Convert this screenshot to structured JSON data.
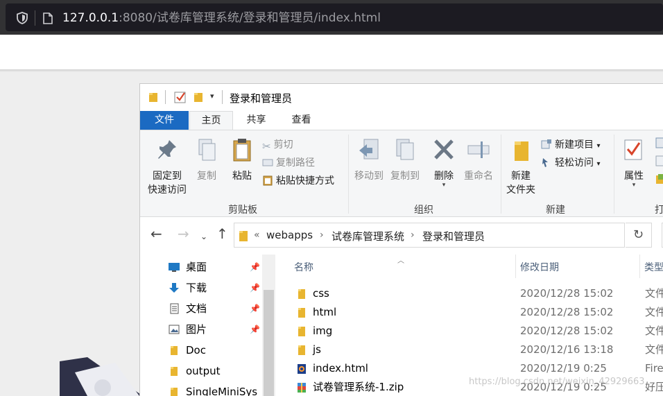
{
  "browser": {
    "url_host": "127.0.0.1",
    "url_rest": ":8080/试卷库管理系统/登录和管理员/index.html"
  },
  "explorer": {
    "title": "登录和管理员",
    "tabs": {
      "file": "文件",
      "home": "主页",
      "share": "共享",
      "view": "查看"
    },
    "ribbon": {
      "pin_quick_access": [
        "固定到",
        "快速访问"
      ],
      "copy": "复制",
      "paste": "粘贴",
      "cut": "剪切",
      "copy_path": "复制路径",
      "paste_shortcut": "粘贴快捷方式",
      "clipboard_group": "剪贴板",
      "move_to": "移动到",
      "copy_to": "复制到",
      "delete": "删除",
      "rename": "重命名",
      "organize_group": "组织",
      "new_folder": [
        "新建",
        "文件夹"
      ],
      "new_item": "新建项目",
      "easy_access": "轻松访问",
      "new_group": "新建",
      "properties": "属性",
      "open_group_partial": "打"
    },
    "address": {
      "overflow": "«",
      "crumbs": [
        "webapps",
        "试卷库管理系统",
        "登录和管理员"
      ]
    },
    "nav_items": [
      {
        "label": "桌面",
        "icon": "desktop-icon",
        "pinned": true
      },
      {
        "label": "下载",
        "icon": "download-icon",
        "pinned": true
      },
      {
        "label": "文档",
        "icon": "document-icon",
        "pinned": true
      },
      {
        "label": "图片",
        "icon": "picture-icon",
        "pinned": true
      },
      {
        "label": "Doc",
        "icon": "folder-icon",
        "pinned": false
      },
      {
        "label": "output",
        "icon": "folder-icon",
        "pinned": false
      },
      {
        "label": "SingleMiniSys",
        "icon": "folder-icon",
        "pinned": false
      }
    ],
    "columns": {
      "name": "名称",
      "date": "修改日期",
      "type": "类型"
    },
    "files": [
      {
        "name": "css",
        "icon": "folder-icon",
        "date": "2020/12/28 15:02",
        "type": "文件"
      },
      {
        "name": "html",
        "icon": "folder-icon",
        "date": "2020/12/28 15:02",
        "type": "文件"
      },
      {
        "name": "img",
        "icon": "folder-icon",
        "date": "2020/12/28 15:02",
        "type": "文件"
      },
      {
        "name": "js",
        "icon": "folder-icon",
        "date": "2020/12/16 13:18",
        "type": "文件"
      },
      {
        "name": "index.html",
        "icon": "html-file-icon",
        "date": "2020/12/19 0:25",
        "type": "Fire"
      },
      {
        "name": "试卷管理系统-1.zip",
        "icon": "zip-file-icon",
        "date": "2020/12/19 0:25",
        "type": "好压"
      }
    ]
  },
  "watermark": "https://blog.csdn.net/weixin_42929663"
}
